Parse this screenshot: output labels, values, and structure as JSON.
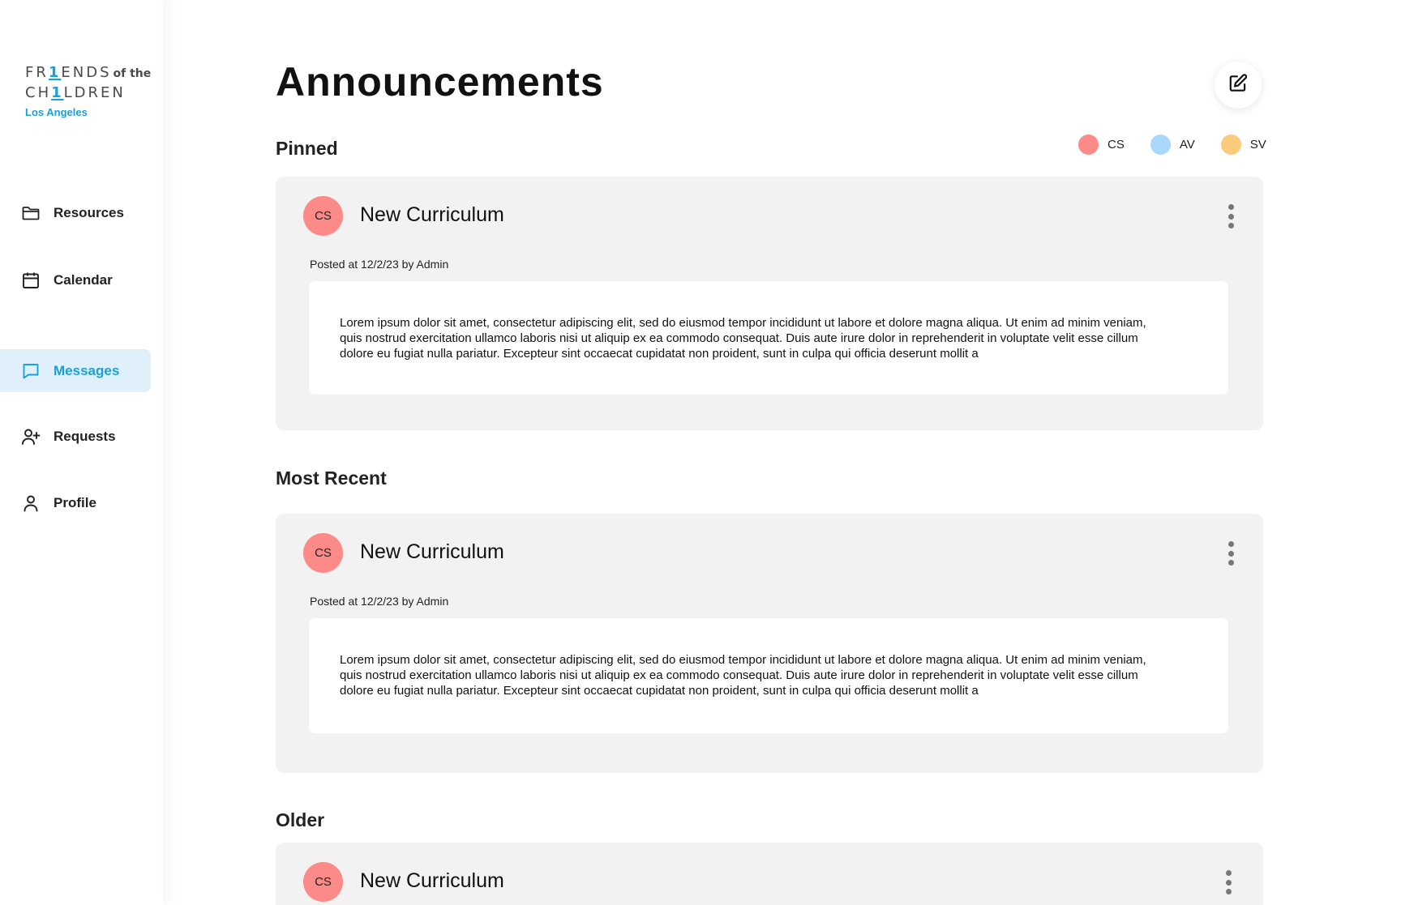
{
  "brand": {
    "logo_line1": "FR",
    "logo_line1_one": "1",
    "logo_line1_rest": "ENDS",
    "logo_ofthe": "of the",
    "logo_line2": "CH",
    "logo_line2_one": "1",
    "logo_line2_rest": "LDREN",
    "logo_city": "Los Angeles",
    "accent": "#1aa0d8"
  },
  "sidebar": {
    "items": [
      {
        "label": "Resources",
        "icon": "folder-icon",
        "active": false
      },
      {
        "label": "Calendar",
        "icon": "calendar-icon",
        "active": false
      },
      {
        "label": "Messages",
        "icon": "message-icon",
        "active": true
      },
      {
        "label": "Requests",
        "icon": "user-plus-icon",
        "active": false
      },
      {
        "label": "Profile",
        "icon": "user-icon",
        "active": false
      }
    ]
  },
  "header": {
    "title": "Announcements",
    "compose_icon": "edit-icon"
  },
  "legend": [
    {
      "label": "CS",
      "color": "#fb8a89"
    },
    {
      "label": "AV",
      "color": "#a9d8fb"
    },
    {
      "label": "SV",
      "color": "#fbcb7c"
    }
  ],
  "sections": {
    "pinned": "Pinned",
    "recent": "Most Recent",
    "older": "Older"
  },
  "posts": [
    {
      "badge": "CS",
      "title": "New Curriculum",
      "meta": "Posted at 12/2/23 by Admin",
      "body": "Lorem ipsum dolor sit amet, consectetur adipiscing elit, sed do eiusmod tempor incididunt ut labore et dolore magna aliqua. Ut enim ad minim veniam, quis nostrud exercitation ullamco laboris nisi ut aliquip ex ea commodo consequat. Duis aute irure dolor in reprehenderit in voluptate velit esse cillum dolore eu fugiat nulla pariatur. Excepteur sint occaecat cupidatat non proident, sunt in culpa qui officia deserunt mollit a"
    },
    {
      "badge": "CS",
      "title": "New Curriculum",
      "meta": "Posted at 12/2/23 by Admin",
      "body": "Lorem ipsum dolor sit amet, consectetur adipiscing elit, sed do eiusmod tempor incididunt ut labore et dolore magna aliqua. Ut enim ad minim veniam, quis nostrud exercitation ullamco laboris nisi ut aliquip ex ea commodo consequat. Duis aute irure dolor in reprehenderit in voluptate velit esse cillum dolore eu fugiat nulla pariatur. Excepteur sint occaecat cupidatat non proident, sunt in culpa qui officia deserunt mollit a"
    },
    {
      "badge": "CS",
      "title": "New Curriculum"
    }
  ]
}
